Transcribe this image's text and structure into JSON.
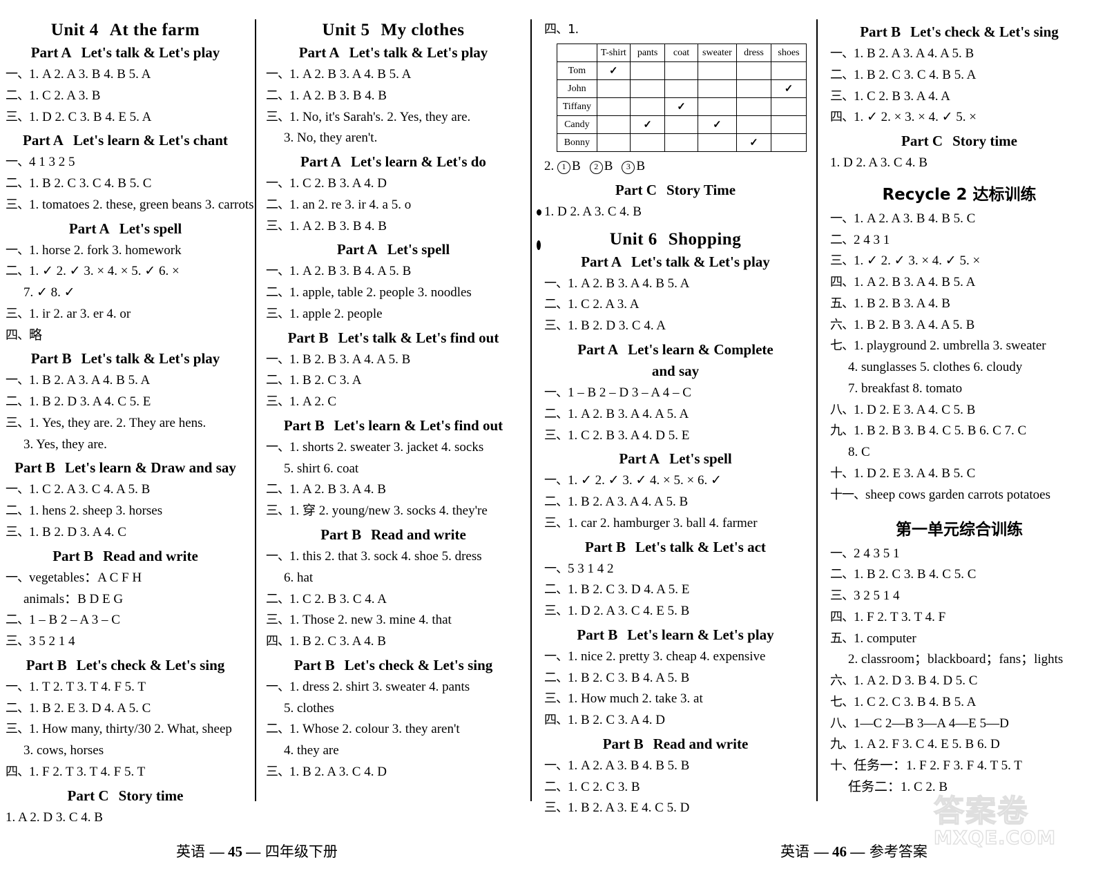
{
  "page": {
    "footer_left": {
      "subject": "英语",
      "page_number": "— 45 —",
      "label": "四年级下册"
    },
    "footer_right": {
      "subject": "英语",
      "page_number": "— 46 —",
      "label": "参考答案"
    },
    "watermark": {
      "line1": "答案卷",
      "line2": "MXQE.COM"
    }
  },
  "col1": {
    "unit_title": {
      "unit": "Unit 4",
      "name": "At the farm"
    },
    "blocks": [
      {
        "heading": {
          "part": "Part A",
          "title": "Let's talk & Let's play"
        },
        "lines": [
          {
            "marker": "一、",
            "text": "1. A   2. A   3. B   4. B   5. A"
          },
          {
            "marker": "二、",
            "text": "1. C   2. A   3. B"
          },
          {
            "marker": "三、",
            "text": "1. D   2. C   3. B   4. E   5. A"
          }
        ]
      },
      {
        "heading": {
          "part": "Part A",
          "title": "Let's learn & Let's chant"
        },
        "lines": [
          {
            "marker": "一、",
            "text": "4   1   3   2   5"
          },
          {
            "marker": "二、",
            "text": "1. B   2. C   3. C   4. B   5. C"
          },
          {
            "marker": "三、",
            "text": "1. tomatoes   2. these, green beans   3. carrots"
          }
        ]
      },
      {
        "heading": {
          "part": "Part A",
          "title": "Let's spell"
        },
        "lines": [
          {
            "marker": "一、",
            "text": "1. horse   2. fork   3. homework"
          },
          {
            "marker": "二、",
            "text": "1. ✓   2. ✓   3. ×   4. ×   5. ✓   6. ×"
          },
          {
            "marker": "",
            "text": "7. ✓   8. ✓",
            "indent": true
          },
          {
            "marker": "三、",
            "text": "1. ir   2. ar   3. er   4. or"
          },
          {
            "marker": "四、",
            "text": "略"
          }
        ]
      },
      {
        "heading": {
          "part": "Part B",
          "title": "Let's talk & Let's play"
        },
        "lines": [
          {
            "marker": "一、",
            "text": "1. B   2. A   3. A   4. B   5. A"
          },
          {
            "marker": "二、",
            "text": "1. B   2. D   3. A   4. C   5. E"
          },
          {
            "marker": "三、",
            "text": "1. Yes, they are.    2. They are hens."
          },
          {
            "marker": "",
            "text": "3. Yes, they are.",
            "indent": true
          }
        ]
      },
      {
        "heading": {
          "part": "Part B",
          "title": "Let's learn & Draw and say"
        },
        "lines": [
          {
            "marker": "一、",
            "text": "1. C   2. A   3. C   4. A   5. B"
          },
          {
            "marker": "二、",
            "text": "1. hens   2. sheep   3. horses"
          },
          {
            "marker": "三、",
            "text": "1. B   2. D   3. A   4. C"
          }
        ]
      },
      {
        "heading": {
          "part": "Part B",
          "title": "Read and write"
        },
        "lines": [
          {
            "marker": "一、",
            "text": "vegetables：A   C   F   H"
          },
          {
            "marker": "",
            "text": "animals：B   D   E   G",
            "indent": true
          },
          {
            "marker": "二、",
            "text": "1 – B   2 – A   3 – C"
          },
          {
            "marker": "三、",
            "text": "3   5   2   1   4"
          }
        ]
      },
      {
        "heading": {
          "part": "Part B",
          "title": "Let's check & Let's sing"
        },
        "lines": [
          {
            "marker": "一、",
            "text": "1. T   2. T   3. T   4. F   5. T"
          },
          {
            "marker": "二、",
            "text": "1. B   2. E   3. D   4. A   5. C"
          },
          {
            "marker": "三、",
            "text": "1. How many, thirty/30   2. What, sheep"
          },
          {
            "marker": "",
            "text": "3. cows, horses",
            "indent": true
          },
          {
            "marker": "四、",
            "text": "1. F   2. T   3. T   4. F   5. T"
          }
        ]
      },
      {
        "heading": {
          "part": "Part C",
          "title": "Story time"
        },
        "lines": [
          {
            "marker": "",
            "text": "1. A   2. D   3. C   4. B"
          }
        ]
      }
    ]
  },
  "col2": {
    "unit_title": {
      "unit": "Unit 5",
      "name": "My clothes"
    },
    "blocks": [
      {
        "heading": {
          "part": "Part A",
          "title": "Let's talk & Let's play"
        },
        "lines": [
          {
            "marker": "一、",
            "text": "1. A   2. B   3. A   4. B   5. A"
          },
          {
            "marker": "二、",
            "text": "1. A   2. B   3. B   4. B"
          },
          {
            "marker": "三、",
            "text": "1. No, it's Sarah's.    2. Yes, they are."
          },
          {
            "marker": "",
            "text": "3. No, they aren't.",
            "indent": true
          }
        ]
      },
      {
        "heading": {
          "part": "Part A",
          "title": "Let's learn & Let's do"
        },
        "lines": [
          {
            "marker": "一、",
            "text": "1. C   2. B   3. A   4. D"
          },
          {
            "marker": "二、",
            "text": "1. an   2. re   3. ir   4. a   5. o"
          },
          {
            "marker": "三、",
            "text": "1. A   2. B   3. B   4. B"
          }
        ]
      },
      {
        "heading": {
          "part": "Part A",
          "title": "Let's spell"
        },
        "lines": [
          {
            "marker": "一、",
            "text": "1. A   2. B   3. B   4. A   5. B"
          },
          {
            "marker": "二、",
            "text": "1. apple, table   2. people   3. noodles"
          },
          {
            "marker": "三、",
            "text": "1. apple   2. people"
          }
        ]
      },
      {
        "heading": {
          "part": "Part B",
          "title": "Let's talk & Let's find out"
        },
        "lines": [
          {
            "marker": "一、",
            "text": "1. B   2. B   3. A   4. A   5. B"
          },
          {
            "marker": "二、",
            "text": "1. B   2. C   3. A"
          },
          {
            "marker": "三、",
            "text": "1. A   2. C"
          }
        ]
      },
      {
        "heading": {
          "part": "Part B",
          "title": "Let's learn & Let's find out"
        },
        "lines": [
          {
            "marker": "一、",
            "text": "1. shorts   2. sweater   3. jacket   4. socks"
          },
          {
            "marker": "",
            "text": "5. shirt   6. coat",
            "indent": true
          },
          {
            "marker": "二、",
            "text": "1. A   2. B   3. A   4. B"
          },
          {
            "marker": "三、",
            "text": "1. 穿   2. young/new   3. socks   4. they're"
          }
        ]
      },
      {
        "heading": {
          "part": "Part B",
          "title": "Read and write"
        },
        "lines": [
          {
            "marker": "一、",
            "text": "1. this   2. that   3. sock   4. shoe   5. dress"
          },
          {
            "marker": "",
            "text": "6. hat",
            "indent": true
          },
          {
            "marker": "二、",
            "text": "1. C   2. B   3. C   4. A"
          },
          {
            "marker": "三、",
            "text": "1. Those   2. new   3. mine   4. that"
          },
          {
            "marker": "四、",
            "text": "1. B   2. C   3. A   4. B"
          }
        ]
      },
      {
        "heading": {
          "part": "Part B",
          "title": "Let's check & Let's sing"
        },
        "lines": [
          {
            "marker": "一、",
            "text": "1. dress   2. shirt   3. sweater   4. pants"
          },
          {
            "marker": "",
            "text": "5. clothes",
            "indent": true
          },
          {
            "marker": "二、",
            "text": "1. Whose   2. colour   3. they aren't"
          },
          {
            "marker": "",
            "text": "4. they are",
            "indent": true
          },
          {
            "marker": "三、",
            "text": "1. B   2. A   3. C   4. D"
          }
        ]
      }
    ]
  },
  "col3": {
    "top_marker": "四、1.",
    "table": {
      "columns": [
        "",
        "T-shirt",
        "pants",
        "coat",
        "sweater",
        "dress",
        "shoes"
      ],
      "rows": [
        {
          "name": "Tom",
          "checks": [
            true,
            false,
            false,
            false,
            false,
            false
          ]
        },
        {
          "name": "John",
          "checks": [
            false,
            false,
            false,
            false,
            false,
            true
          ]
        },
        {
          "name": "Tiffany",
          "checks": [
            false,
            false,
            true,
            false,
            false,
            false
          ]
        },
        {
          "name": "Candy",
          "checks": [
            false,
            true,
            false,
            true,
            false,
            false
          ]
        },
        {
          "name": "Bonny",
          "checks": [
            false,
            false,
            false,
            false,
            true,
            false
          ]
        }
      ]
    },
    "after_table": {
      "prefix": "2.",
      "items": [
        {
          "num": "1",
          "ans": "B"
        },
        {
          "num": "2",
          "ans": "B"
        },
        {
          "num": "3",
          "ans": "B"
        }
      ]
    },
    "story_heading": {
      "part": "Part C",
      "title": "Story Time"
    },
    "story_line": "1. D   2. A   3. C   4. B",
    "unit_title": {
      "unit": "Unit 6",
      "name": "Shopping"
    },
    "blocks": [
      {
        "heading": {
          "part": "Part A",
          "title": "Let's talk & Let's play"
        },
        "lines": [
          {
            "marker": "一、",
            "text": "1. A   2. B   3. A   4. B   5. A"
          },
          {
            "marker": "二、",
            "text": "1. C   2. A   3. A"
          },
          {
            "marker": "三、",
            "text": "1. B   2. D   3. C   4. A"
          }
        ]
      },
      {
        "heading": {
          "part": "Part A",
          "title": "Let's learn & Complete",
          "title2": "and say"
        },
        "lines": [
          {
            "marker": "一、",
            "text": "1 – B   2 – D   3 – A   4 – C"
          },
          {
            "marker": "二、",
            "text": "1. A   2. B   3. A   4. A   5. A"
          },
          {
            "marker": "三、",
            "text": "1. C   2. B   3. A   4. D   5. E"
          }
        ]
      },
      {
        "heading": {
          "part": "Part A",
          "title": "Let's spell"
        },
        "lines": [
          {
            "marker": "一、",
            "text": "1. ✓   2. ✓   3. ✓   4. ×   5. ×   6. ✓"
          },
          {
            "marker": "二、",
            "text": "1. B   2. A   3. A   4. A   5. B"
          },
          {
            "marker": "三、",
            "text": "1. car   2. hamburger   3. ball   4. farmer"
          }
        ]
      },
      {
        "heading": {
          "part": "Part B",
          "title": "Let's talk & Let's act"
        },
        "lines": [
          {
            "marker": "一、",
            "text": "5   3   1   4   2"
          },
          {
            "marker": "二、",
            "text": "1. B   2. C   3. D   4. A   5. E"
          },
          {
            "marker": "三、",
            "text": "1. D   2. A   3. C   4. E   5. B"
          }
        ]
      },
      {
        "heading": {
          "part": "Part B",
          "title": "Let's learn & Let's play"
        },
        "lines": [
          {
            "marker": "一、",
            "text": "1. nice   2. pretty   3. cheap   4. expensive"
          },
          {
            "marker": "二、",
            "text": "1. B   2. C   3. B   4. A   5. B"
          },
          {
            "marker": "三、",
            "text": "1. How much   2. take   3. at"
          },
          {
            "marker": "四、",
            "text": "1. B   2. C   3. A   4. D"
          }
        ]
      },
      {
        "heading": {
          "part": "Part B",
          "title": "Read and write"
        },
        "lines": [
          {
            "marker": "一、",
            "text": "1. A   2. A   3. B   4. B   5. B"
          },
          {
            "marker": "二、",
            "text": "1. C   2. C   3. B"
          },
          {
            "marker": "三、",
            "text": "1. B   2. A   3. E   4. C   5. D"
          }
        ]
      }
    ]
  },
  "col4": {
    "blocks": [
      {
        "heading": {
          "part": "Part B",
          "title": "Let's check & Let's sing"
        },
        "lines": [
          {
            "marker": "一、",
            "text": "1. B   2. A   3. A   4. A   5. B"
          },
          {
            "marker": "二、",
            "text": "1. B   2. C   3. C   4. B   5. A"
          },
          {
            "marker": "三、",
            "text": "1. C   2. B   3. A   4. A"
          },
          {
            "marker": "四、",
            "text": "1. ✓   2. ×   3. ×   4. ✓   5. ×"
          }
        ]
      },
      {
        "heading": {
          "part": "Part C",
          "title": "Story time"
        },
        "lines": [
          {
            "marker": "",
            "text": "1. D   2. A   3. C   4. B"
          }
        ]
      }
    ],
    "recycle_title": "Recycle 2 达标训练",
    "recycle_lines": [
      {
        "marker": "一、",
        "text": "1. A   2. A   3. B   4. B   5. C"
      },
      {
        "marker": "二、",
        "text": "2   4   3   1"
      },
      {
        "marker": "三、",
        "text": "1. ✓   2. ✓   3. ×   4. ✓   5. ×"
      },
      {
        "marker": "四、",
        "text": "1. A   2. B   3. A   4. B   5. A"
      },
      {
        "marker": "五、",
        "text": "1. B   2. B   3. A   4. B"
      },
      {
        "marker": "六、",
        "text": "1. B   2. B   3. A   4. A   5. B"
      },
      {
        "marker": "七、",
        "text": "1. playground   2. umbrella   3. sweater"
      },
      {
        "marker": "",
        "text": "4. sunglasses   5. clothes   6. cloudy",
        "indent": true
      },
      {
        "marker": "",
        "text": "7. breakfast   8. tomato",
        "indent": true
      },
      {
        "marker": "八、",
        "text": "1. D   2. E   3. A   4. C   5. B"
      },
      {
        "marker": "九、",
        "text": "1. B   2. B   3. B   4. C   5. B   6. C   7. C"
      },
      {
        "marker": "",
        "text": "8. C",
        "indent": true
      },
      {
        "marker": "十、",
        "text": "1. D   2. E   3. A   4. B   5. C"
      },
      {
        "marker": "十一、",
        "text": "sheep   cows   garden   carrots   potatoes"
      }
    ],
    "exam_title": "第一单元综合训练",
    "exam_lines": [
      {
        "marker": "一、",
        "text": "2   4   3   5   1"
      },
      {
        "marker": "二、",
        "text": "1. B   2. C   3. B   4. C   5. C"
      },
      {
        "marker": "三、",
        "text": "3   2   5   1   4"
      },
      {
        "marker": "四、",
        "text": "1. F   2. T   3. T   4. F"
      },
      {
        "marker": "五、",
        "text": "1. computer"
      },
      {
        "marker": "",
        "text": "2. classroom；blackboard；fans；lights",
        "indent": true
      },
      {
        "marker": "六、",
        "text": "1. A   2. D   3. B   4. D   5. C"
      },
      {
        "marker": "七、",
        "text": "1. C   2. C   3. B   4. B   5. A"
      },
      {
        "marker": "八、",
        "text": "1—C   2—B   3—A   4—E   5—D"
      },
      {
        "marker": "九、",
        "text": "1. A   2. F   3. C   4. E   5. B   6. D"
      },
      {
        "marker": "十、",
        "text": "任务一：1. F   2. F   3. F   4. T   5. T"
      },
      {
        "marker": "",
        "text": "任务二：1. C   2. B",
        "indent": true
      }
    ]
  }
}
